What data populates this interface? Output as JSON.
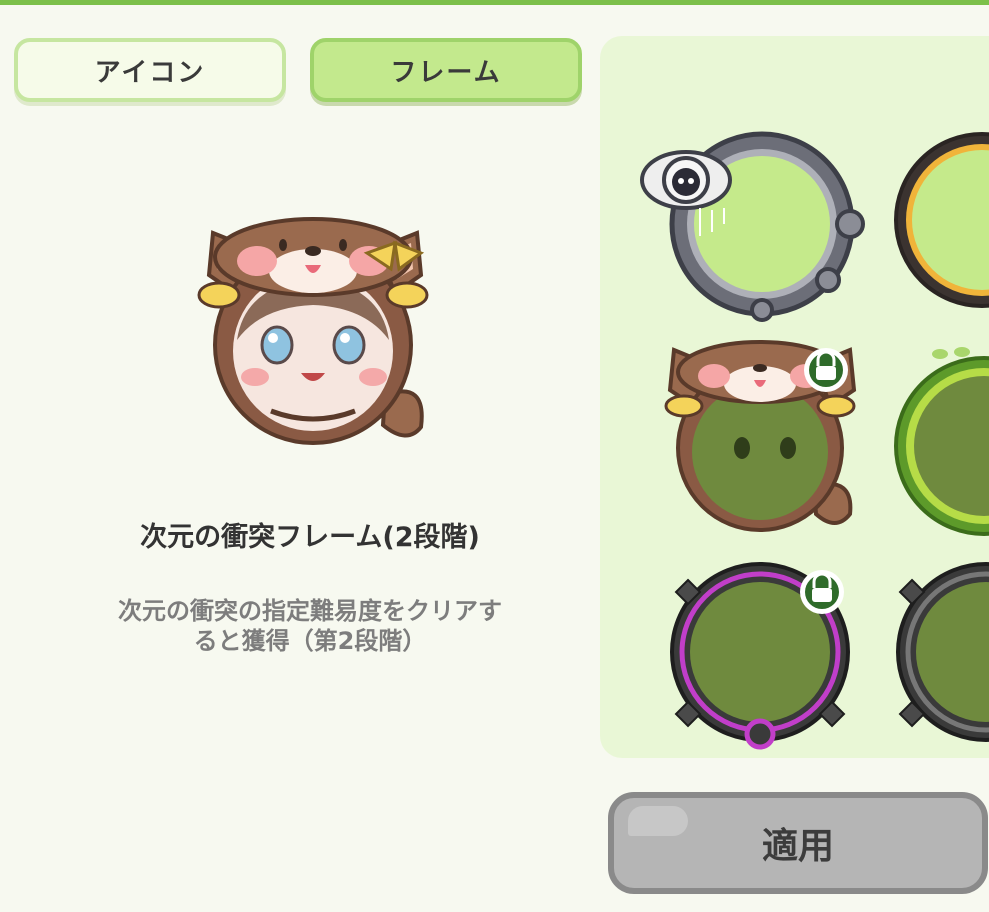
{
  "tabs": [
    {
      "label": "アイコン",
      "selected": false
    },
    {
      "label": "フレーム",
      "selected": true
    }
  ],
  "selected_frame": {
    "name": "次元の衝突フレーム(2段階)",
    "description": "次元の衝突の指定難易度をクリアすると獲得（第2段階）"
  },
  "frames": [
    {
      "name": "space-station-frame",
      "locked": false
    },
    {
      "name": "gold-ring-frame",
      "locked": false
    },
    {
      "name": "dog-hood-frame",
      "locked": true
    },
    {
      "name": "leaf-vine-frame",
      "locked": false
    },
    {
      "name": "purple-spike-frame",
      "locked": true
    },
    {
      "name": "dark-spike-frame",
      "locked": false
    }
  ],
  "apply_button": {
    "label": "適用"
  },
  "colors": {
    "accent_green": "#7cc04a",
    "tab_selected": "#c3e98d",
    "panel_bg": "#e9f7d6",
    "apply_disabled": "#b5b5b5"
  }
}
